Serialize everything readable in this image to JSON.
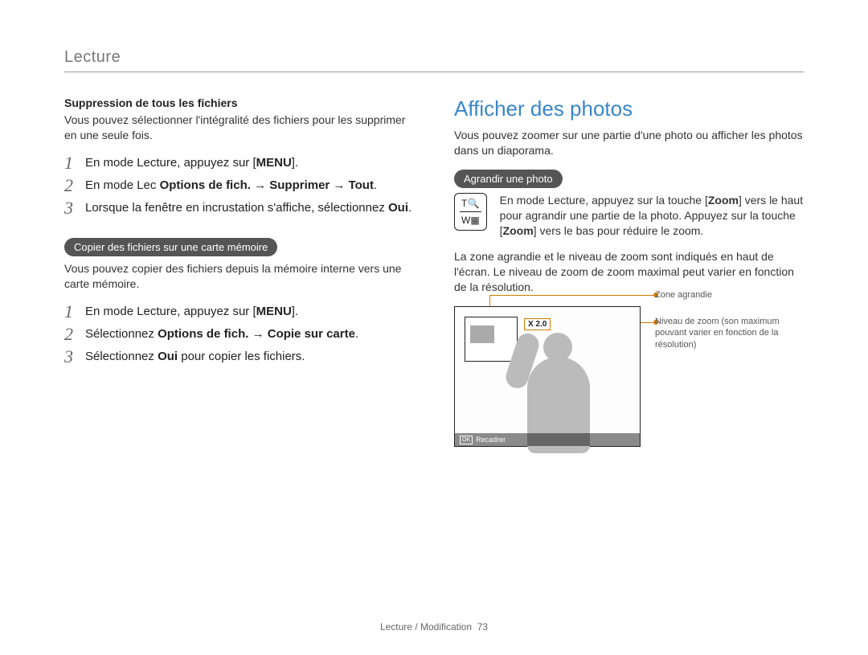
{
  "header": {
    "section": "Lecture"
  },
  "left": {
    "delete_all": {
      "heading": "Suppression de tous les fichiers",
      "intro": "Vous pouvez sélectionner l'intégralité des fichiers pour les supprimer en une seule fois.",
      "steps": [
        {
          "num": "1",
          "pre": "En mode Lecture, appuyez sur [",
          "bold": "MENU",
          "post": "]."
        },
        {
          "num": "2",
          "pre": "En mode Lec ",
          "bold": "Options de fich. → Supprimer → Tout",
          "post": "."
        },
        {
          "num": "3",
          "pre": "Lorsque la fenêtre en incrustation s'affiche, sélectionnez ",
          "bold": "Oui",
          "post": "."
        }
      ]
    },
    "copy_card": {
      "pill": "Copier des fichiers sur une carte mémoire",
      "intro": "Vous pouvez copier des fichiers depuis la mémoire interne vers une carte mémoire.",
      "steps": [
        {
          "num": "1",
          "pre": "En mode Lecture, appuyez sur [",
          "bold": "MENU",
          "post": "]."
        },
        {
          "num": "2",
          "pre": "Sélectionnez ",
          "bold": "Options de fich. → Copie sur carte",
          "post": "."
        },
        {
          "num": "3",
          "pre": "Sélectionnez ",
          "bold": "Oui",
          "post": " pour copier les fichiers."
        }
      ]
    }
  },
  "right": {
    "title": "Afficher des photos",
    "intro": "Vous pouvez zoomer sur une partie d'une photo ou afficher les photos dans un diaporama.",
    "zoom": {
      "pill": "Agrandir une photo",
      "toggle_top_left": "T",
      "toggle_bottom_left": "W",
      "desc_pre": "En mode Lecture, appuyez sur la touche [",
      "desc_b1": "Zoom",
      "desc_mid": "] vers le haut pour agrandir une partie de la photo. Appuyez sur la touche [",
      "desc_b2": "Zoom",
      "desc_post": "] vers le bas pour réduire le zoom.",
      "after": "La zone agrandie et le niveau de zoom sont indiqués en haut de l'écran. Le niveau de zoom de zoom maximal peut varier en fonction de la résolution.",
      "badge": "X 2.0",
      "okbar_icon": "OK",
      "okbar_label": "Recadrer",
      "callout1": "Zone agrandie",
      "callout2": "Niveau de zoom (son maximum pouvant varier en fonction de la résolution)"
    }
  },
  "footer": {
    "text": "Lecture / Modification",
    "page": "73"
  },
  "icons": {
    "magnifier": "🔍",
    "grid": "▦"
  }
}
